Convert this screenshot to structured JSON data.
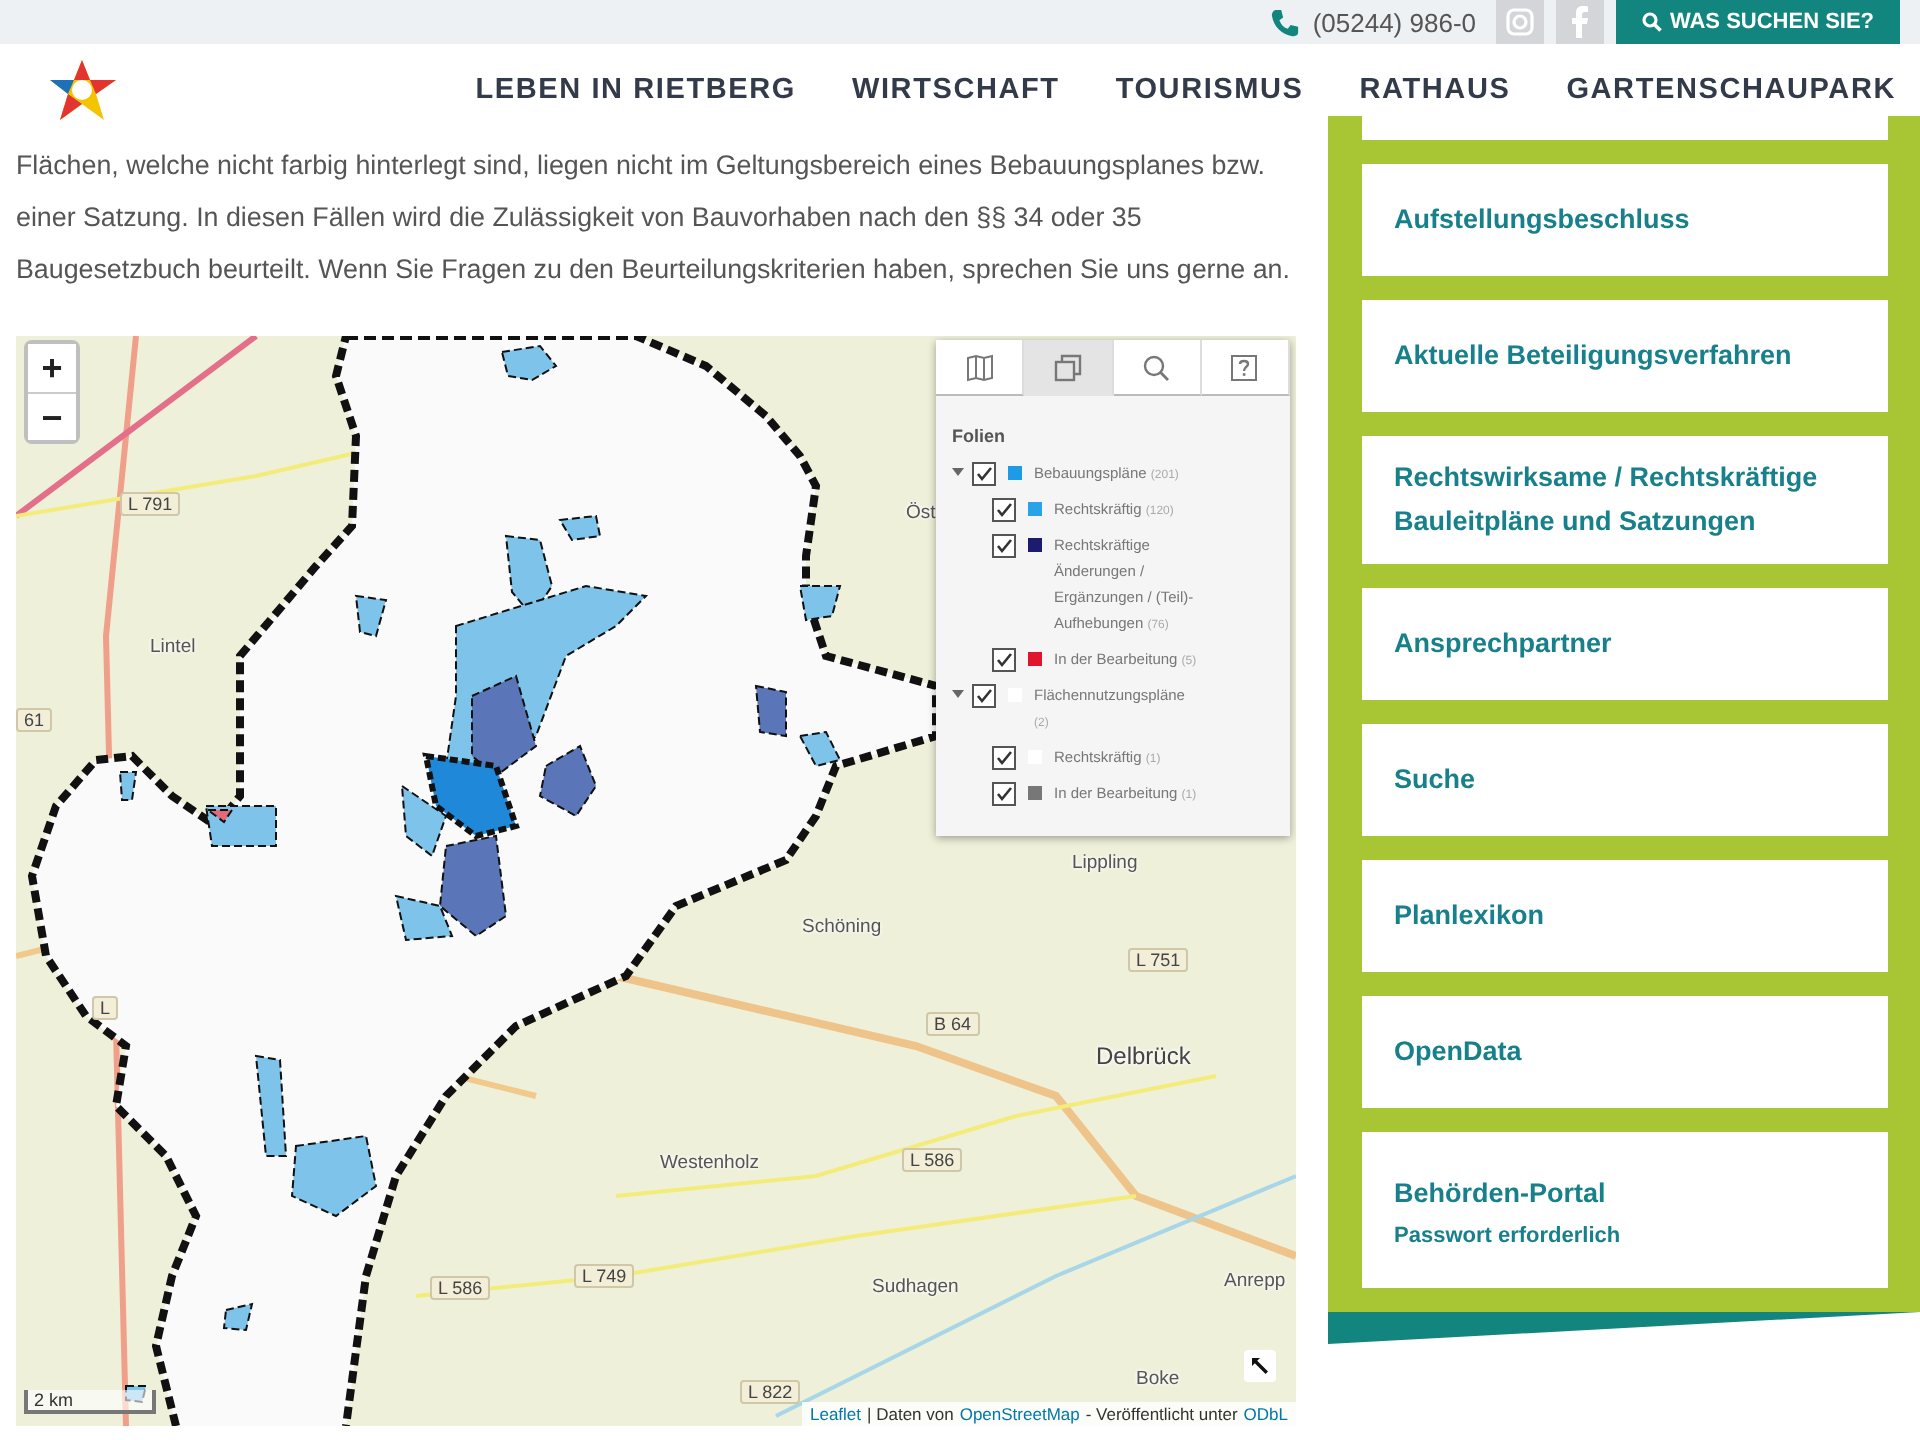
{
  "top_bar": {
    "phone": "(05244) 986-0",
    "search_button": "WAS SUCHEN SIE?"
  },
  "nav": {
    "items": [
      "LEBEN IN RIETBERG",
      "WIRTSCHAFT",
      "TOURISMUS",
      "RATHAUS",
      "GARTENSCHAUPARK"
    ]
  },
  "intro": "Flächen, welche nicht farbig hinterlegt sind, liegen nicht im Geltungsbereich eines Bebauungsplanes bzw. einer Satzung. In diesen Fällen wird die Zulässigkeit von Bauvorhaben nach den §§ 34 oder 35 Baugesetzbuch beurteilt. Wenn Sie Fragen zu den Beurteilungskriterien haben, sprechen Sie uns gerne an.",
  "map": {
    "zoom_in": "+",
    "zoom_out": "−",
    "place_labels": [
      "Lintel",
      "Öst",
      "Lippling",
      "Schöning",
      "Delbrück",
      "Westenholz",
      "Sudhagen",
      "Anrepp",
      "Boke"
    ],
    "road_labels": [
      "L 791",
      "61",
      "L 751",
      "B 64",
      "L 586",
      "L 586",
      "L 749",
      "L 822",
      "L"
    ],
    "scale": "2 km",
    "attribution": {
      "leaflet": "Leaflet",
      "text_1": "| Daten von",
      "osm": "OpenStreetMap",
      "text_2": "- Veröffentlicht unter",
      "license": "ODbL"
    },
    "layer_panel": {
      "tabs": [
        {
          "kind": "map",
          "selected": false
        },
        {
          "kind": "layers",
          "selected": true
        },
        {
          "kind": "search",
          "selected": false
        },
        {
          "kind": "help",
          "selected": false
        }
      ],
      "heading": "Folien",
      "layers": [
        {
          "label": "Bebauungspläne",
          "count": "(201)",
          "checked": true,
          "expanded": true,
          "color": "#1e9be6",
          "children": [
            {
              "label": "Rechtskräftig",
              "count": "(120)",
              "checked": true,
              "color": "#29a3e8"
            },
            {
              "label": "Rechtskräftige Änderungen / Ergänzungen / (Teil)-Aufhebungen",
              "count": "(76)",
              "checked": true,
              "color": "#1c1c6e"
            },
            {
              "label": "In der Bearbeitung",
              "count": "(5)",
              "checked": true,
              "color": "#e0142c"
            }
          ]
        },
        {
          "label": "Flächennutzungspläne",
          "count": "(2)",
          "checked": true,
          "expanded": true,
          "color": "#ffffff",
          "children": [
            {
              "label": "Rechtskräftig",
              "count": "(1)",
              "checked": true,
              "color": "#ffffff"
            },
            {
              "label": "In der Bearbeitung",
              "count": "(1)",
              "checked": true,
              "color": "#777777"
            }
          ]
        }
      ]
    }
  },
  "sidebar": {
    "items": [
      {
        "title": "Aufstellungsbeschluss"
      },
      {
        "title": "Aktuelle Beteiligungsverfahren"
      },
      {
        "title": "Rechtswirksame / Rechtskräftige Bauleitpläne und Satzungen"
      },
      {
        "title": "Ansprechpartner"
      },
      {
        "title": "Suche"
      },
      {
        "title": "Planlexikon"
      },
      {
        "title": "OpenData"
      },
      {
        "title": "Behörden-Portal",
        "subtitle": "Passwort erforderlich"
      }
    ]
  }
}
